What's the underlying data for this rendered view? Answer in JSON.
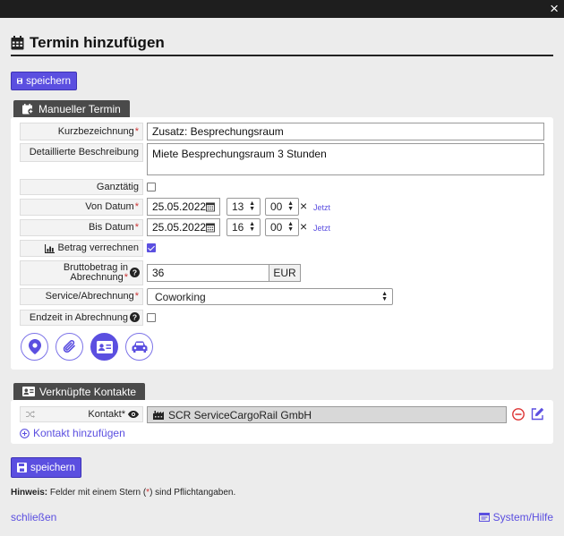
{
  "dialog": {
    "title": "Termin hinzufügen",
    "close_label": "×"
  },
  "toolbar": {
    "save_label": "speichern"
  },
  "manual": {
    "tab_label": "Manueller Termin",
    "fields": {
      "kurz_label": "Kurzbezeichnung",
      "kurz_value": "Zusatz: Besprechungsraum",
      "desc_label": "Detaillierte Beschreibung",
      "desc_value": "Miete Besprechungsraum 3 Stunden",
      "ganztag_label": "Ganztätig",
      "ganztag_checked": false,
      "von_label": "Von Datum",
      "von_date": "25.05.2022",
      "von_hour": "13",
      "von_min": "00",
      "bis_label": "Bis Datum",
      "bis_date": "25.05.2022",
      "bis_hour": "16",
      "bis_min": "00",
      "clear_symbol": "×",
      "now_label": "Jetzt",
      "betrag_label": "Betrag verrechnen",
      "betrag_checked": true,
      "brutto_label_1": "Bruttobetrag in",
      "brutto_label_2": "Abrechnung",
      "brutto_value": "36",
      "currency": "EUR",
      "service_label": "Service/Abrechnung",
      "service_value": "Coworking",
      "endzeit_label": "Endzeit in Abrechnung",
      "endzeit_checked": false,
      "required_mark": "*"
    },
    "icon_buttons": [
      "location-icon",
      "attachment-icon",
      "contact-card-icon",
      "car-icon"
    ]
  },
  "contacts": {
    "tab_label": "Verknüpfte Kontakte",
    "kontakt_label": "Kontakt",
    "kontakt_value": "SCR ServiceCargoRail GmbH",
    "add_label": "Kontakt hinzufügen"
  },
  "footer": {
    "hint_bold": "Hinweis:",
    "hint_pre": " Felder mit einem Stern (",
    "hint_star": "*",
    "hint_post": ") sind Pflichtangaben.",
    "close_link": "schließen",
    "help_link": "System/Hilfe"
  },
  "colors": {
    "accent": "#5b4fe0",
    "dark": "#4a4a4a",
    "danger": "#d33"
  }
}
